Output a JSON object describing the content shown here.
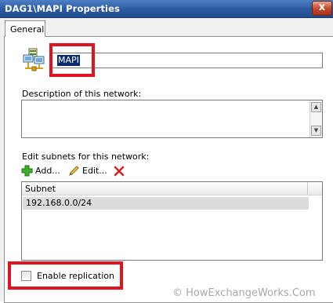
{
  "window": {
    "title": "DAG1\\MAPI Properties"
  },
  "tabs": [
    {
      "label": "General"
    }
  ],
  "general": {
    "name_value": "MAPI",
    "description_label": "Description of this network:",
    "description_value": "",
    "subnets_label": "Edit subnets for this network:",
    "toolbar": {
      "add_label": "Add...",
      "edit_label": "Edit...",
      "remove_icon": "red-x-icon"
    },
    "subnets_table": {
      "columns": [
        "Subnet"
      ],
      "rows": [
        {
          "subnet": "192.168.0.0/24"
        }
      ]
    },
    "replication": {
      "label": "Enable replication",
      "checked": false
    }
  },
  "watermark": "© HowExchangeWorks.Com",
  "colors": {
    "titlebar": "#2b5aa0",
    "highlight": "#e0141f",
    "selection": "#0a2a6e"
  }
}
